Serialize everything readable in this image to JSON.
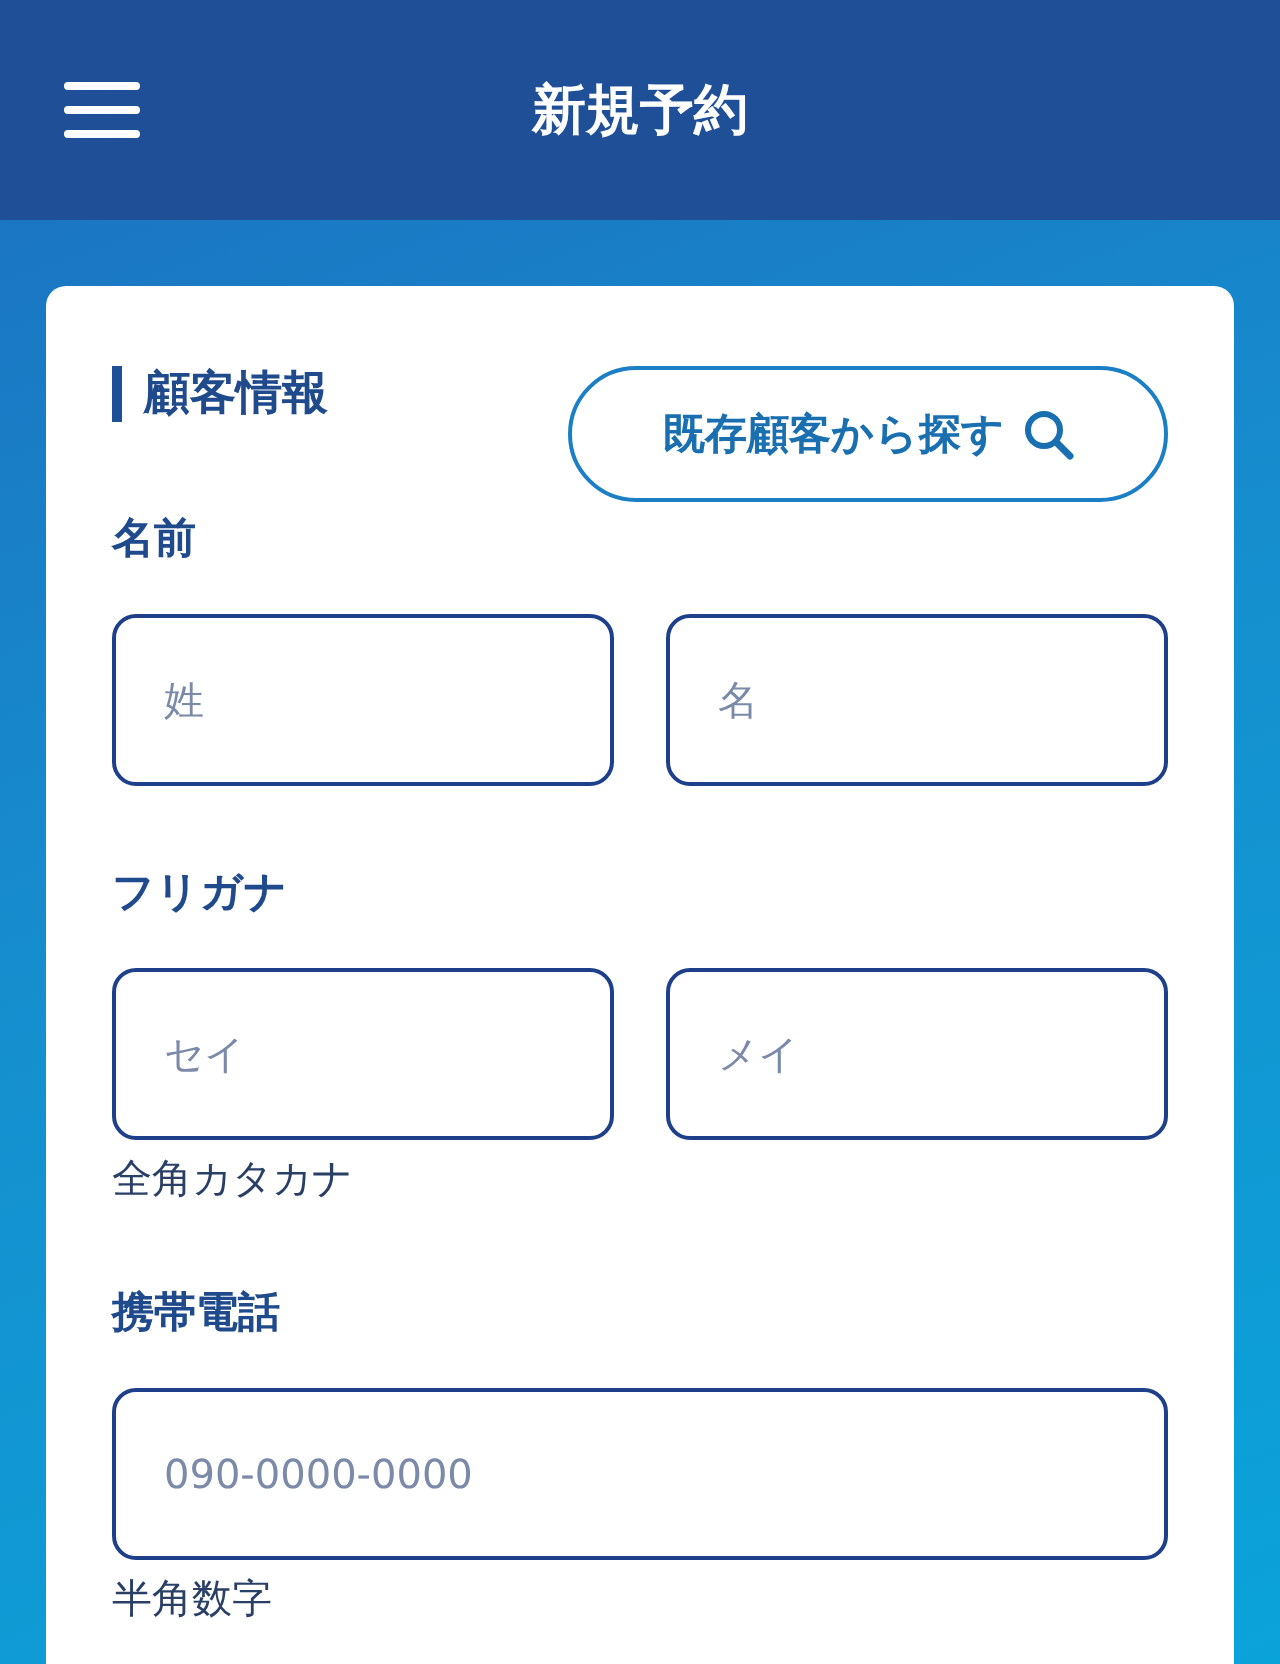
{
  "header": {
    "title": "新規予約"
  },
  "section": {
    "title": "顧客情報",
    "search_button": "既存顧客から探す"
  },
  "fields": [
    {
      "label": "名前",
      "inputs": [
        {
          "placeholder": "姓"
        },
        {
          "placeholder": "名"
        }
      ]
    },
    {
      "label": "フリガナ",
      "inputs": [
        {
          "placeholder": "セイ"
        },
        {
          "placeholder": "メイ"
        }
      ],
      "hint": "全角カタカナ"
    },
    {
      "label": "携帯電話",
      "inputs": [
        {
          "placeholder": "090-0000-0000"
        }
      ],
      "hint": "半角数字"
    }
  ]
}
